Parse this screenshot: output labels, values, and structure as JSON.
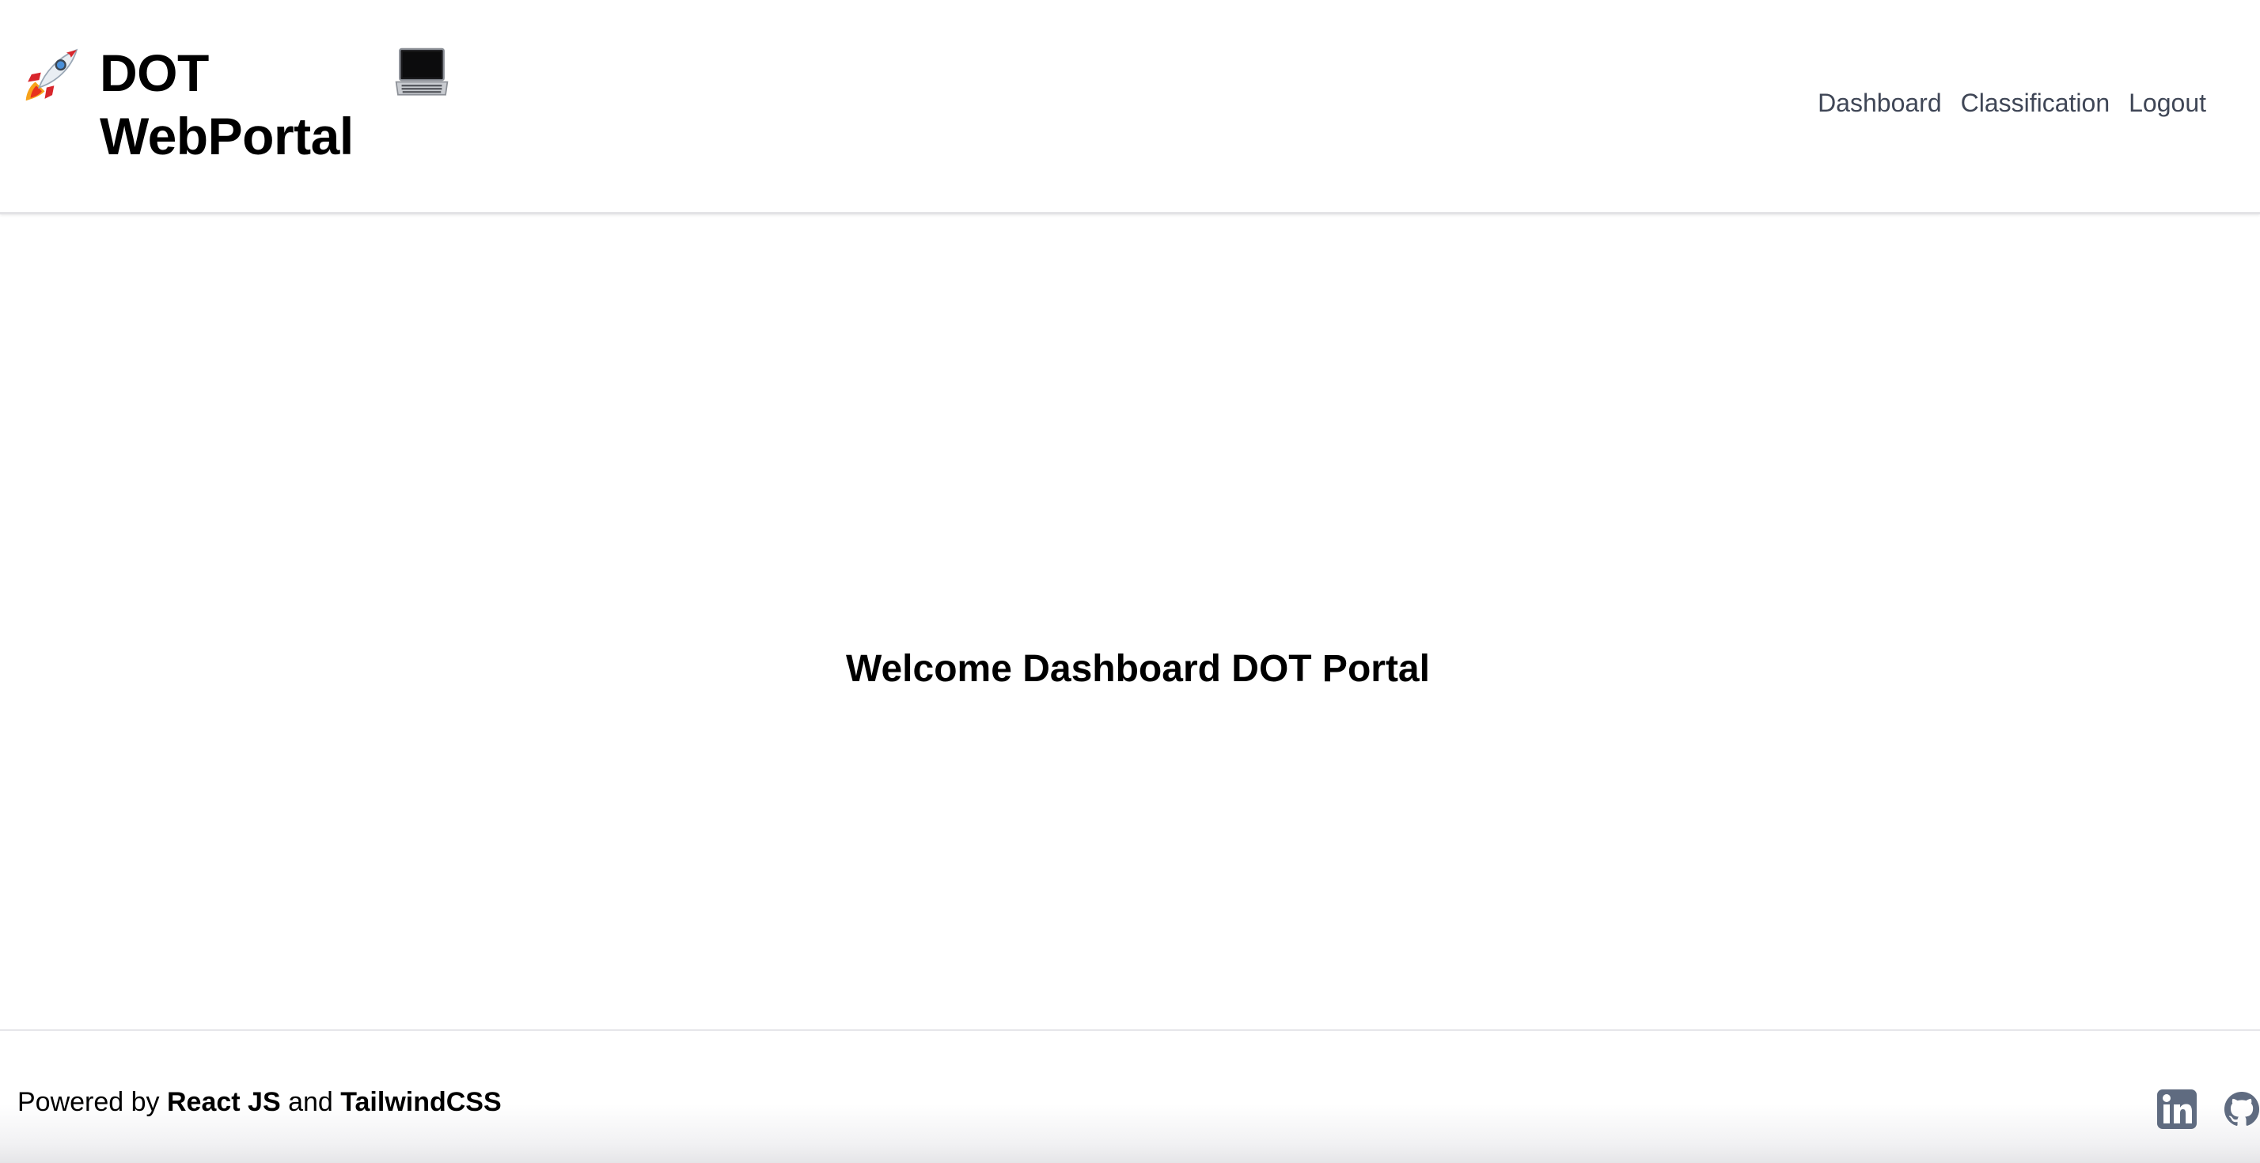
{
  "header": {
    "brand_title": "DOT WebPortal",
    "brand_icon_left": "rocket-icon",
    "brand_icon_right": "laptop-icon",
    "nav": [
      {
        "label": "Dashboard"
      },
      {
        "label": "Classification"
      },
      {
        "label": "Logout"
      }
    ]
  },
  "main": {
    "welcome_text": "Welcome Dashboard DOT Portal"
  },
  "footer": {
    "prefix": "Powered by",
    "tech1": "React JS",
    "conjunction": "and",
    "tech2": "TailwindCSS",
    "social": [
      {
        "icon": "linkedin-icon"
      },
      {
        "icon": "github-icon"
      }
    ]
  },
  "colors": {
    "nav_text": "#3f4656",
    "social_icon": "#5f6b80",
    "divider": "#e3e3e6"
  }
}
